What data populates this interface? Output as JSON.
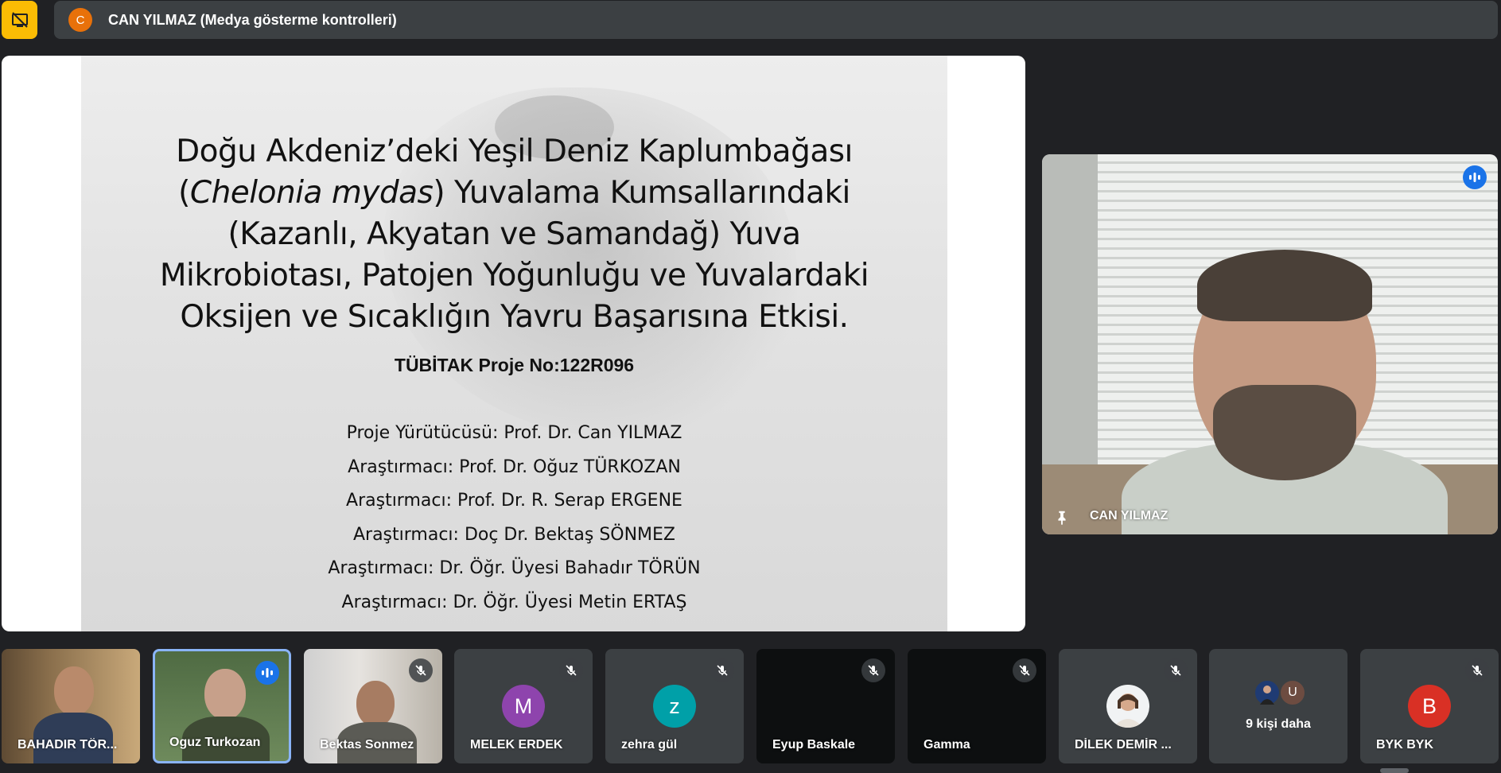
{
  "top_bar": {
    "presenter_initial": "C",
    "presenter_label": "CAN YILMAZ (Medya gösterme kontrolleri)"
  },
  "slide": {
    "title_line1": "Doğu Akdeniz’deki Yeşil Deniz Kaplumbağası",
    "title_line2_open": "(",
    "title_line2_italic": "Chelonia mydas",
    "title_line2_rest": ") Yuvalama Kumsallarındaki",
    "title_line3": "(Kazanlı, Akyatan ve Samandağ) Yuva",
    "title_line4": "Mikrobiotası, Patojen Yoğunluğu ve Yuvalardaki",
    "title_line5": "Oksijen ve Sıcaklığın Yavru Başarısına Etkisi.",
    "subtitle": "TÜBİTAK Proje No:122R096",
    "credits": [
      "Proje Yürütücüsü: Prof. Dr. Can YILMAZ",
      "Araştırmacı: Prof. Dr. Oğuz TÜRKOZAN",
      "Araştırmacı: Prof. Dr. R. Serap ERGENE",
      "Araştırmacı: Doç Dr. Bektaş SÖNMEZ",
      "Araştırmacı: Dr. Öğr. Üyesi Bahadır TÖRÜN",
      "Araştırmacı: Dr. Öğr. Üyesi Metin ERTAŞ"
    ]
  },
  "speaker": {
    "name": "CAN YILMAZ"
  },
  "participants": [
    {
      "name": "BAHADIR TÖR..."
    },
    {
      "name": "Oguz Turkozan"
    },
    {
      "name": "Bektas Sonmez"
    },
    {
      "name": "MELEK ERDEK",
      "initial": "M",
      "color": "#8e44ad"
    },
    {
      "name": "zehra gül",
      "initial": "z",
      "color": "#00a0a8"
    },
    {
      "name": "Eyup Baskale"
    },
    {
      "name": "Gamma"
    },
    {
      "name": "DİLEK DEMİR ..."
    },
    {
      "more_label": "9 kişi daha",
      "initial": "U"
    },
    {
      "name": "BYK BYK",
      "initial": "B",
      "color": "#d93025"
    }
  ],
  "colors": {
    "accent": "#1a73e8",
    "present_icon_bg": "#fbbc04",
    "background": "#202124",
    "tile_bg": "#3c4043"
  }
}
